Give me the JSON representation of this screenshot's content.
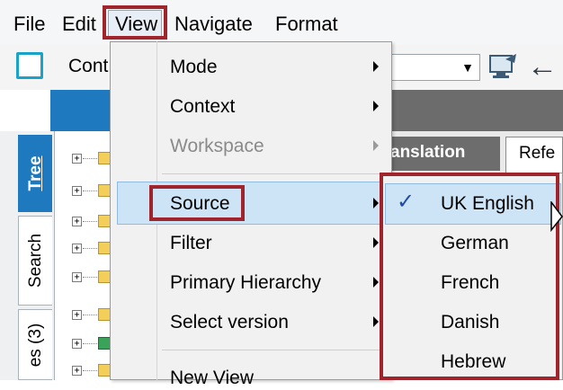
{
  "menubar": {
    "items": [
      "File",
      "Edit",
      "View",
      "Navigate",
      "Format"
    ]
  },
  "toolbar": {
    "context_label_partial": "Cont"
  },
  "side_tabs": {
    "tree": "Tree",
    "search": "Search",
    "notes_partial": "es (3)"
  },
  "right_tabs": {
    "translation_partial": "anslation",
    "refer_partial": "Refe"
  },
  "view_menu": {
    "items": [
      {
        "label": "Mode",
        "has_submenu": true,
        "disabled": false
      },
      {
        "label": "Context",
        "has_submenu": true,
        "disabled": false
      },
      {
        "label": "Workspace",
        "has_submenu": true,
        "disabled": true
      },
      {
        "label": "Source",
        "has_submenu": true,
        "disabled": false,
        "highlighted": true
      },
      {
        "label": "Filter",
        "has_submenu": true,
        "disabled": false
      },
      {
        "label": "Primary Hierarchy",
        "has_submenu": true,
        "disabled": false
      },
      {
        "label": "Select version",
        "has_submenu": true,
        "disabled": false
      },
      {
        "label": "New View",
        "has_submenu": false,
        "disabled": false
      }
    ]
  },
  "source_submenu": {
    "items": [
      {
        "label": "UK English",
        "checked": true
      },
      {
        "label": "German",
        "checked": false
      },
      {
        "label": "French",
        "checked": false
      },
      {
        "label": "Danish",
        "checked": false
      },
      {
        "label": "Hebrew",
        "checked": false
      }
    ],
    "check_glyph": "✓"
  },
  "colors": {
    "accent_blue": "#1f79bf",
    "highlight_red": "#a0242c",
    "menu_hover": "#cde4f7"
  }
}
